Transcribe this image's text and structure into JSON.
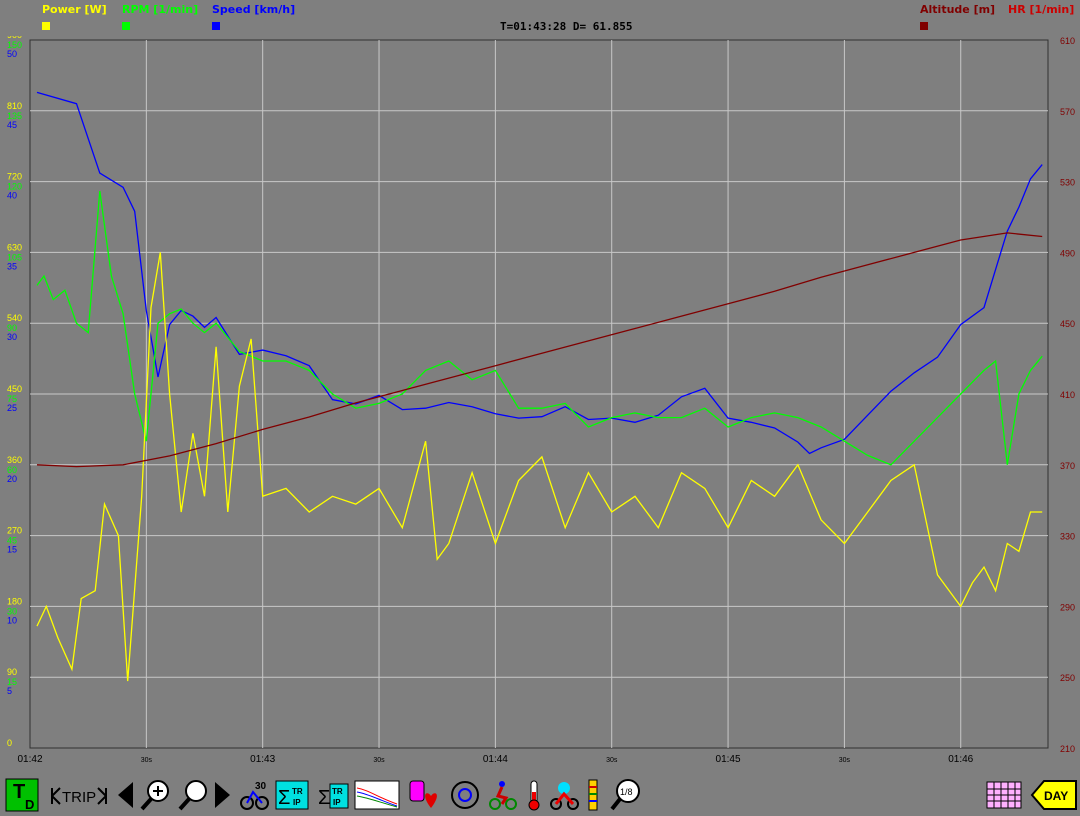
{
  "header": {
    "legend": [
      {
        "label": "Power [W]",
        "color": "#ffff00"
      },
      {
        "label": "RPM [1/min]",
        "color": "#00ff00"
      },
      {
        "label": "Speed [km/h]",
        "color": "#0000ff"
      },
      {
        "label": "Altitude [m]",
        "color": "#800000"
      },
      {
        "label": "HR [1/min]",
        "color": "#cc0000"
      }
    ],
    "status_text": "T=01:43:28  D=  61.855"
  },
  "chart_data": {
    "type": "line",
    "title": "",
    "x_ticks": [
      "01:42",
      "30s",
      "01:43",
      "30s",
      "01:44",
      "30s",
      "01:45",
      "30s",
      "01:46"
    ],
    "x_range_min": [
      0,
      4.375
    ],
    "axes": {
      "power": {
        "label": "Power [W]",
        "ticks": [
          "0",
          "90",
          "180",
          "270",
          "360",
          "450",
          "540",
          "630",
          "720",
          "810",
          "900"
        ],
        "range": [
          0,
          900
        ]
      },
      "rpm": {
        "label": "RPM [1/min]",
        "ticks": [
          "15",
          "30",
          "45",
          "60",
          "75",
          "90",
          "105",
          "120",
          "135",
          "150"
        ],
        "range": [
          0,
          150
        ]
      },
      "speed": {
        "label": "Speed [km/h]",
        "ticks": [
          "5",
          "10",
          "15",
          "20",
          "25",
          "30",
          "35",
          "40",
          "45",
          "50"
        ],
        "range": [
          0,
          50
        ]
      },
      "right": {
        "label": "Altitude [m]",
        "ticks": [
          "210",
          "250",
          "290",
          "330",
          "370",
          "410",
          "450",
          "490",
          "530",
          "570",
          "610"
        ],
        "range": [
          210,
          610
        ]
      }
    },
    "grid": true,
    "series": [
      {
        "name": "Speed [km/h]",
        "color": "#0000ff",
        "x": [
          0.03,
          0.2,
          0.3,
          0.4,
          0.45,
          0.5,
          0.55,
          0.6,
          0.65,
          0.7,
          0.75,
          0.8,
          0.9,
          1.0,
          1.1,
          1.2,
          1.3,
          1.4,
          1.5,
          1.6,
          1.7,
          1.8,
          1.9,
          2.0,
          2.1,
          2.2,
          2.3,
          2.4,
          2.5,
          2.6,
          2.7,
          2.8,
          2.9,
          3.0,
          3.1,
          3.2,
          3.3,
          3.35,
          3.4,
          3.5,
          3.6,
          3.7,
          3.8,
          3.9,
          4.0,
          4.1,
          4.15,
          4.2,
          4.25,
          4.3,
          4.35
        ],
        "y": [
          46.3,
          45.5,
          40.6,
          39.6,
          37.9,
          30.9,
          26.2,
          29.9,
          30.9,
          30.5,
          29.7,
          30.4,
          27.8,
          28.1,
          27.7,
          27.0,
          24.6,
          24.3,
          24.9,
          23.9,
          24.0,
          24.4,
          24.1,
          23.6,
          23.3,
          23.4,
          24.1,
          23.2,
          23.3,
          23.0,
          23.5,
          24.8,
          25.4,
          23.3,
          23.0,
          22.6,
          21.6,
          20.8,
          21.2,
          21.8,
          23.5,
          25.2,
          26.5,
          27.6,
          29.9,
          31.1,
          33.8,
          36.5,
          38.2,
          40.2,
          41.2
        ]
      },
      {
        "name": "RPM [1/min]",
        "color": "#00ff00",
        "x": [
          0.03,
          0.06,
          0.1,
          0.15,
          0.2,
          0.25,
          0.3,
          0.35,
          0.4,
          0.45,
          0.5,
          0.55,
          0.6,
          0.65,
          0.7,
          0.75,
          0.8,
          0.9,
          1.0,
          1.1,
          1.2,
          1.3,
          1.4,
          1.5,
          1.6,
          1.7,
          1.8,
          1.9,
          2.0,
          2.1,
          2.2,
          2.3,
          2.4,
          2.5,
          2.6,
          2.7,
          2.8,
          2.9,
          3.0,
          3.1,
          3.2,
          3.3,
          3.4,
          3.5,
          3.6,
          3.7,
          3.8,
          3.9,
          4.0,
          4.1,
          4.15,
          4.2,
          4.25,
          4.3,
          4.35
        ],
        "y": [
          98,
          100,
          95,
          97,
          90,
          88,
          118,
          100,
          92,
          75,
          65,
          90,
          92,
          93,
          90,
          88,
          90,
          84,
          82,
          82,
          80,
          75,
          72,
          73,
          75,
          80,
          82,
          78,
          80,
          72,
          72,
          73,
          68,
          70,
          71,
          70,
          70,
          72,
          68,
          70,
          71,
          70,
          68,
          65,
          62,
          60,
          65,
          70,
          75,
          80,
          82,
          60,
          75,
          80,
          83
        ]
      },
      {
        "name": "Power [W]",
        "color": "#ffff00",
        "x": [
          0.03,
          0.07,
          0.12,
          0.18,
          0.22,
          0.28,
          0.32,
          0.38,
          0.42,
          0.48,
          0.52,
          0.56,
          0.6,
          0.65,
          0.7,
          0.75,
          0.8,
          0.85,
          0.9,
          0.95,
          1.0,
          1.1,
          1.2,
          1.3,
          1.4,
          1.5,
          1.6,
          1.7,
          1.75,
          1.8,
          1.9,
          2.0,
          2.1,
          2.2,
          2.3,
          2.4,
          2.5,
          2.6,
          2.7,
          2.8,
          2.9,
          3.0,
          3.1,
          3.2,
          3.3,
          3.4,
          3.5,
          3.6,
          3.7,
          3.8,
          3.9,
          4.0,
          4.05,
          4.1,
          4.15,
          4.2,
          4.25,
          4.3,
          4.35
        ],
        "y": [
          155,
          180,
          140,
          100,
          190,
          200,
          310,
          270,
          85,
          320,
          560,
          630,
          450,
          300,
          400,
          320,
          510,
          300,
          460,
          520,
          320,
          330,
          300,
          320,
          310,
          330,
          280,
          390,
          240,
          260,
          350,
          260,
          340,
          370,
          280,
          350,
          300,
          320,
          280,
          350,
          330,
          280,
          340,
          320,
          360,
          290,
          260,
          300,
          340,
          360,
          220,
          180,
          210,
          230,
          200,
          260,
          250,
          300,
          300
        ]
      },
      {
        "name": "Altitude [m]",
        "color": "#800000",
        "x": [
          0.03,
          0.2,
          0.4,
          0.6,
          0.8,
          1.0,
          1.2,
          1.4,
          1.6,
          1.8,
          2.0,
          2.2,
          2.4,
          2.6,
          2.8,
          3.0,
          3.2,
          3.4,
          3.6,
          3.8,
          4.0,
          4.2,
          4.35
        ],
        "y": [
          370,
          369,
          370,
          375,
          382,
          390,
          397,
          405,
          412,
          419,
          426,
          433,
          440,
          447,
          454,
          461,
          468,
          476,
          483,
          490,
          497,
          501,
          499
        ]
      }
    ]
  },
  "toolbar": {
    "trip_label": "TRIP",
    "day_label": "DAY",
    "lap_label": "30",
    "sum_label": "TR IP",
    "zoom_label": "1/8"
  }
}
